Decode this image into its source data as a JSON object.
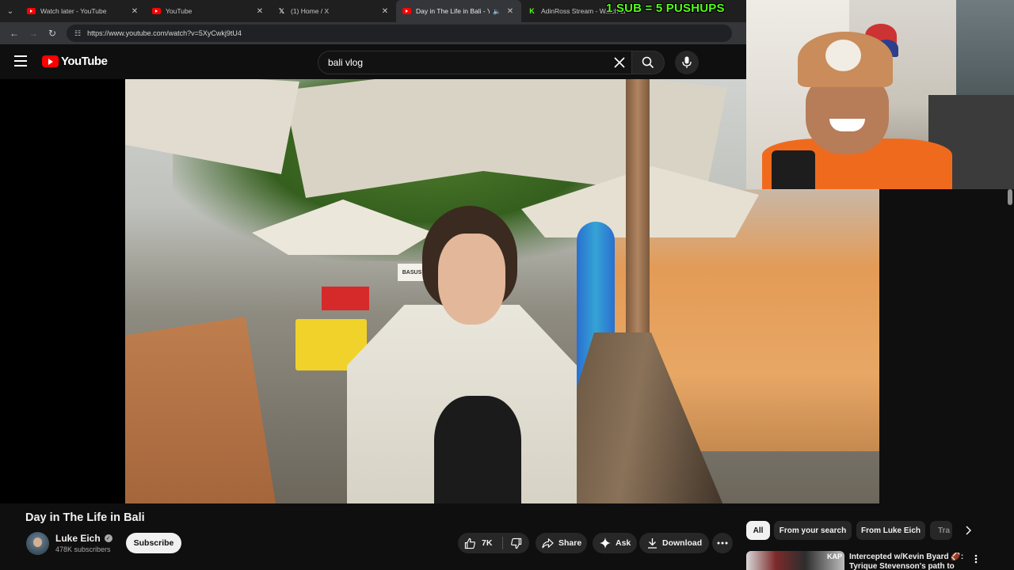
{
  "browser": {
    "tabs": [
      {
        "label": "Watch later - YouTube",
        "favicon": "youtube-icon",
        "active": false
      },
      {
        "label": "YouTube",
        "favicon": "youtube-icon",
        "active": false
      },
      {
        "label": "(1) Home / X",
        "favicon": "x-icon",
        "active": false
      },
      {
        "label": "Day in The Life in Bali - You",
        "favicon": "youtube-icon",
        "active": true,
        "audio": true
      },
      {
        "label": "AdinRoss Stream - Watch Li",
        "favicon": "kick-icon",
        "active": false
      }
    ],
    "url": "https://www.youtube.com/watch?v=5XyCwkj9tU4"
  },
  "stream_overlay": {
    "promo_text": "1 SUB = 5 PUSHUPS",
    "promo_color": "#53fc18"
  },
  "header": {
    "logo_text": "YouTube",
    "search_value": "bali vlog",
    "brand_color": "#ff0000"
  },
  "video": {
    "sign_text": "BASUS INK",
    "title": "Day in The Life in Bali",
    "channel": "Luke Eich",
    "subscribers": "478K subscribers",
    "subscribe_label": "Subscribe",
    "likes": "7K",
    "share_label": "Share",
    "ask_label": "Ask",
    "download_label": "Download"
  },
  "sidebar": {
    "chips": [
      "All",
      "From your search",
      "From Luke Eich",
      "Tra"
    ],
    "selected_chip": "All",
    "recommendation": {
      "title": "Intercepted w/Kevin Byard 🏈: Tyrique Stevenson's path to N...",
      "thumb_text": "KAP"
    }
  }
}
